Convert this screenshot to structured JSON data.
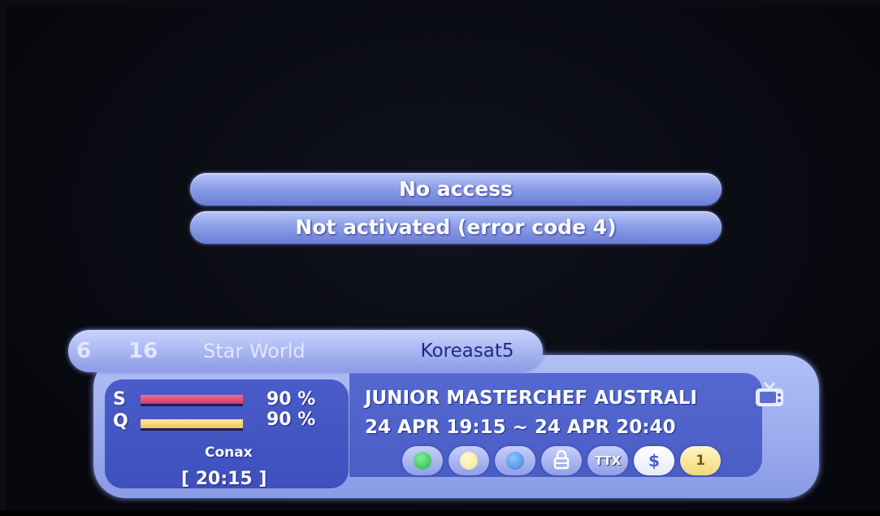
{
  "messages": {
    "line1": "No access",
    "line2": "Not activated (error code 4)"
  },
  "channel": {
    "number_prefix": "6",
    "number": "16",
    "name": "Star World",
    "satellite": "Koreasat5"
  },
  "signal": {
    "s_label": "S",
    "q_label": "Q",
    "strength": "90 %",
    "quality": "90 %",
    "ca_system": "Conax",
    "time": "[ 20:15 ]"
  },
  "program": {
    "title": "JUNIOR MASTERCHEF AUSTRALI",
    "schedule": "24 APR 19:15 ~ 24 APR 20:40"
  },
  "icons": [
    {
      "name": "green-button-icon",
      "color": "#22b24a"
    },
    {
      "name": "yellow-button-icon",
      "color": "#f2e38a"
    },
    {
      "name": "blue-button-icon",
      "color": "#3a7fd8"
    },
    {
      "name": "lock-icon",
      "text": "🔒"
    },
    {
      "name": "teletext-icon",
      "text": "TTX"
    },
    {
      "name": "scrambled-icon",
      "text": "$"
    },
    {
      "name": "audio-track-icon",
      "text": "1"
    }
  ],
  "colors": {
    "accent": "#8d9ee8",
    "panel_dark": "#4a5cc8",
    "text_dark_blue": "#1c2a8a"
  }
}
